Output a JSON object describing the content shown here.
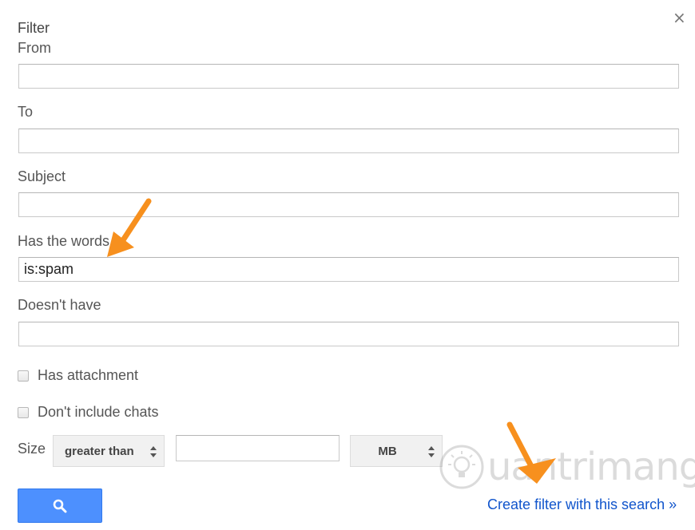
{
  "dialog": {
    "title": "Filter",
    "close_glyph": "×"
  },
  "fields": {
    "from": {
      "label": "From",
      "value": ""
    },
    "to": {
      "label": "To",
      "value": ""
    },
    "subject": {
      "label": "Subject",
      "value": ""
    },
    "has_words": {
      "label": "Has the words",
      "value": "is:spam"
    },
    "doesnt_have": {
      "label": "Doesn't have",
      "value": ""
    }
  },
  "checkboxes": {
    "has_attachment": {
      "label": "Has attachment",
      "checked": false
    },
    "dont_include_chats": {
      "label": "Don't include chats",
      "checked": false
    }
  },
  "size": {
    "label": "Size",
    "comparator": "greater than",
    "value": "",
    "unit": "MB"
  },
  "actions": {
    "search_icon": "search-icon",
    "create_filter_link": "Create filter with this search »"
  },
  "overlay": {
    "watermark_text": "uantrimang",
    "arrow_color": "#f7901e"
  },
  "colors": {
    "primary_button": "#4d90fe",
    "link": "#1155cc"
  }
}
